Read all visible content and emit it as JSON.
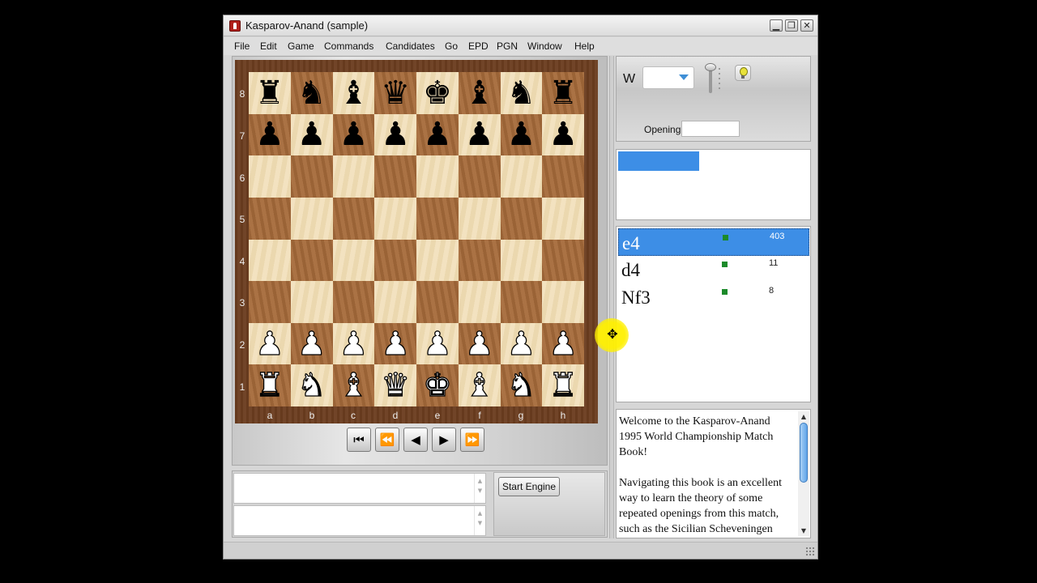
{
  "window": {
    "title": "Kasparov-Anand (sample)",
    "controls": {
      "minimize": "▁",
      "restore": "❐",
      "close": "✕"
    }
  },
  "menu": [
    "File",
    "Edit",
    "Game",
    "Commands",
    "Candidates",
    "Go",
    "EPD",
    "PGN",
    "Window",
    "Help"
  ],
  "board": {
    "ranks": [
      "8",
      "7",
      "6",
      "5",
      "4",
      "3",
      "2",
      "1"
    ],
    "files": [
      "a",
      "b",
      "c",
      "d",
      "e",
      "f",
      "g",
      "h"
    ],
    "position": [
      "rnbqkbnr",
      "pppppppp",
      "........",
      "........",
      "........",
      "........",
      "PPPPPPPP",
      "RNBQKBNR"
    ],
    "light_color": "#f0dcb2",
    "dark_color": "#a66a3a"
  },
  "navigation": {
    "first": "⏮",
    "back_fast": "⏪",
    "back": "◀",
    "forward": "▶",
    "forward_fast": "⏩"
  },
  "engine": {
    "start_label": "Start Engine"
  },
  "book": {
    "side_label": "W",
    "opening_label": "Opening",
    "opening_value": ""
  },
  "moves": [
    {
      "san": "e4",
      "count": "403",
      "selected": true
    },
    {
      "san": "d4",
      "count": "11",
      "selected": false
    },
    {
      "san": "Nf3",
      "count": "8",
      "selected": false
    }
  ],
  "comment": {
    "paragraph1": "Welcome to the Kasparov-Anand 1995 World Championship Match Book!",
    "paragraph2": "Navigating this book is an excellent way to learn the theory of some repeated openings from this match, such as the Sicilian Scheveningen"
  },
  "cursor": {
    "icon": "✥"
  },
  "colors": {
    "selection": "#3d8ee6",
    "book_dot": "#1b8a2a",
    "cursor_highlight": "#fff000"
  }
}
